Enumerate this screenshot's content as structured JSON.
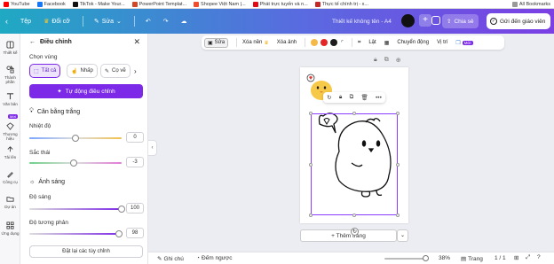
{
  "bookmarks": {
    "items": [
      {
        "label": "YouTube",
        "color": "#ff0000"
      },
      {
        "label": "Facebook",
        "color": "#1877f2"
      },
      {
        "label": "TikTok - Make Your...",
        "color": "#111111"
      },
      {
        "label": "PowerPoint Templat...",
        "color": "#d24726"
      },
      {
        "label": "Shopee Việt Nam |...",
        "color": "#ee4d2d"
      },
      {
        "label": "Phát trực tuyến và n...",
        "color": "#e50914"
      },
      {
        "label": "Thực tế chính trị - x...",
        "color": "#c62828"
      }
    ],
    "all_label": "All Bookmarks"
  },
  "topbar": {
    "file_label": "Tệp",
    "resize_label": "Đổi cỡ",
    "edit_label": "Sửa",
    "doc_title": "Thiết kế không tên - A4",
    "share_label": "Chia sẻ",
    "send_label": "Gửi đến giáo viên"
  },
  "rail": {
    "items": [
      "Thiết kế",
      "Thành phần",
      "Văn bản",
      "Thương hiệu",
      "Tải lên",
      "Công cụ",
      "Dự án",
      "Ứng dụng"
    ],
    "badge": "Mới"
  },
  "panel": {
    "title": "Điều chỉnh",
    "choose_area": "Chọn vùng",
    "chips": [
      "Tất cả",
      "Nhấp",
      "Cọ vẽ"
    ],
    "auto_adjust": "Tự động điều chỉnh",
    "white_balance": "Cân bằng trắng",
    "temperature_label": "Nhiệt độ",
    "temperature_value": "0",
    "temperature_pct": 0.5,
    "tint_label": "Sắc thái",
    "tint_value": "-3",
    "tint_pct": 0.48,
    "light_section": "Ánh sáng",
    "brightness_label": "Độ sáng",
    "brightness_value": "100",
    "brightness_pct": 1.0,
    "contrast_label": "Độ tương phản",
    "contrast_value": "98",
    "contrast_pct": 0.97,
    "reset_label": "Đặt lại các tùy chỉnh"
  },
  "context_toolbar": {
    "edit_label": "Sửa",
    "remove_bg_label": "Xóa nền",
    "delete_image_label": "Xóa ảnh",
    "flip_label": "Lật",
    "animate_label": "Chuyển động",
    "position_label": "Vị trí",
    "new_badge": "Mới",
    "colors": [
      "#f5b94a",
      "#e52626",
      "#1c1c1c"
    ]
  },
  "canvas": {
    "add_page_label": "+ Thêm trang"
  },
  "statusbar": {
    "notes_label": "Ghi chú",
    "timer_label": "Đếm ngược",
    "zoom_value": "38%",
    "zoom_pct": 0.38,
    "pages_label": "Trang",
    "page_count": "1 / 1"
  }
}
